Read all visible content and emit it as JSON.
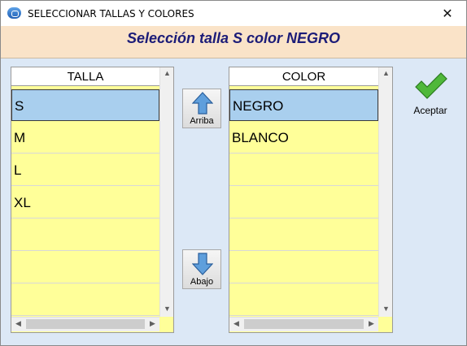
{
  "window": {
    "title": "SELECCIONAR TALLAS Y COLORES",
    "close_glyph": "✕"
  },
  "banner": {
    "text": "Selección  talla S color NEGRO",
    "color": "#1c1c78",
    "background": "#fae3c8"
  },
  "talla_grid": {
    "header": "TALLA",
    "rows": [
      "S",
      "M",
      "L",
      "XL",
      "",
      "",
      ""
    ],
    "selected_index": 0
  },
  "color_grid": {
    "header": "COLOR",
    "rows": [
      "NEGRO",
      "BLANCO",
      "",
      "",
      "",
      "",
      ""
    ],
    "selected_index": 0
  },
  "buttons": {
    "up_label": "Arriba",
    "down_label": "Abajo",
    "accept_label": "Aceptar"
  },
  "icons": {
    "app": "app-logo-icon",
    "close": "close-icon",
    "up": "up-arrow-icon",
    "down": "down-arrow-icon",
    "accept": "checkmark-icon"
  },
  "colors": {
    "row_fill": "#ffff99",
    "selected_fill": "#a9cfee",
    "window_bg": "#dce8f6"
  }
}
